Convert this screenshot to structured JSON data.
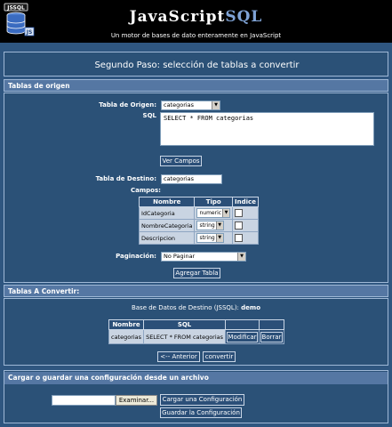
{
  "header": {
    "title_main": "JavaScript",
    "title_accent": "SQL",
    "subtitle": "Un motor de bases de dato enteramente en JavaScript",
    "logo_text": "JSSQL"
  },
  "step": {
    "title": "Segundo Paso: selección de tablas a convertir"
  },
  "origen": {
    "section_title": "Tablas de origen",
    "tabla_origen_label": "Tabla de Origen:",
    "tabla_origen_value": "categorias",
    "sql_label": "SQL",
    "sql_value": "SELECT * FROM categorias",
    "ver_campos_label": "Ver Campos",
    "tabla_destino_label": "Tabla de Destino:",
    "tabla_destino_value": "categorias",
    "campos_label": "Campos:",
    "campos_headers": [
      "Nombre",
      "Tipo",
      "Indice"
    ],
    "campos_rows": [
      {
        "nombre": "IdCategoria",
        "tipo": "numeric"
      },
      {
        "nombre": "NombreCategoria",
        "tipo": "string"
      },
      {
        "nombre": "Descripcion",
        "tipo": "string"
      }
    ],
    "paginacion_label": "Paginación:",
    "paginacion_value": "No Paginar",
    "agregar_label": "Agregar Tabla"
  },
  "convertir": {
    "section_title": "Tablas A Convertir:",
    "base_label": "Base de Datos de Destino (JSSQL):",
    "base_value": "demo",
    "headers": [
      "Nombre",
      "SQL"
    ],
    "rows": [
      {
        "nombre": "categorias",
        "sql": "SELECT * FROM categorias",
        "modificar": "Modificar",
        "borrar": "Borrar"
      }
    ],
    "anterior_label": "<-- Anterior",
    "convertir_label": "convertir"
  },
  "config": {
    "section_title": "Cargar o guardar una configuración desde un archivo",
    "examinar_label": "Examinar...",
    "cargar_label": "Cargar una Configuración",
    "guardar_label": "Guardar la Configuración"
  },
  "colors": {
    "background": "#2f5680",
    "header_bg": "#000000",
    "section_head": "#5577a3",
    "title_accent": "#7fa3d6"
  }
}
